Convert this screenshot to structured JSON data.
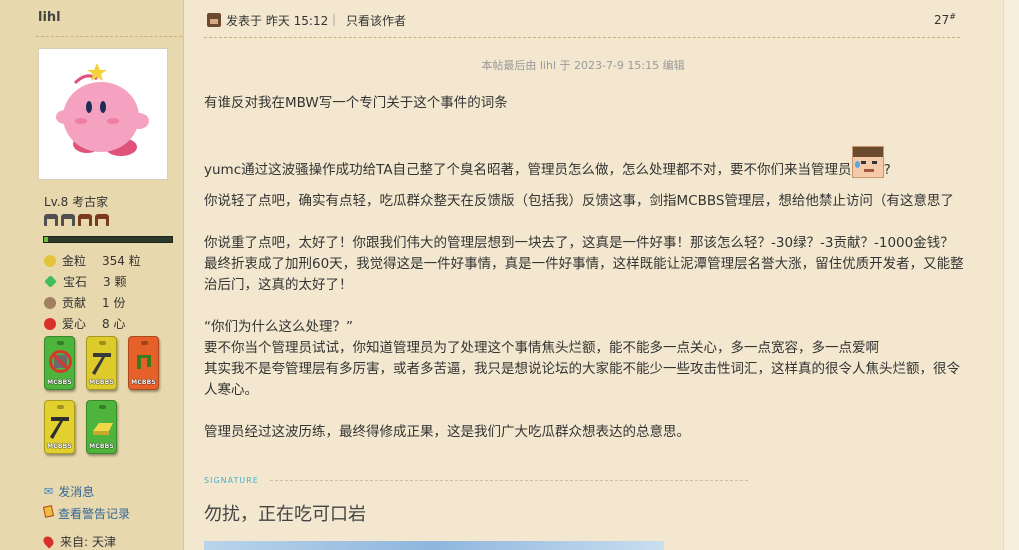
{
  "user": {
    "name": "lihl",
    "level": "Lv.8 考古家",
    "xp_fraction": 0.03,
    "stats": [
      {
        "name": "金粒",
        "value": "354 粒",
        "icon": "gold-nugget-icon",
        "color": "#e6c33a"
      },
      {
        "name": "宝石",
        "value": "3 颗",
        "icon": "emerald-icon",
        "color": "#3fbf5a"
      },
      {
        "name": "贡献",
        "value": "1 份",
        "icon": "contribution-icon",
        "color": "#a08060"
      },
      {
        "name": "爱心",
        "value": "8 心",
        "icon": "heart-apple-icon",
        "color": "#d8312a"
      }
    ],
    "badge_label": "MCBBS",
    "links": [
      {
        "label": "发消息",
        "icon": "mail-icon"
      },
      {
        "label": "查看警告记录",
        "icon": "warning-card-icon"
      }
    ],
    "origin_label": "来自:",
    "origin_value": "天津"
  },
  "post": {
    "posted_label": "发表于 昨天 15:12",
    "separator": "|",
    "only_author_label": "只看该作者",
    "floor_number": "27",
    "floor_mark": "#",
    "edited_note": "本帖最后由 lihl 于 2023-7-9 15:15 编辑",
    "paragraphs": [
      "有谁反对我在MBW写一个专门关于这个事件的词条",
      "yumc通过这波骚操作成功给TA自己整了个臭名昭著，管理员怎么做，怎么处理都不对，要不你们来当管理员",
      "你说轻了点吧，确实有点轻，吃瓜群众整天在反馈版（包括我）反馈这事，剑指MCBBS管理层，想给他禁止访问（有这意思了",
      "你说重了点吧，太好了！你跟我们伟大的管理层想到一块去了，这真是一件好事！那该怎么轻？-30绿？-3贡献？-1000金钱？最终折衷成了加刑60天，我觉得这是一件好事情，真是一件好事情，这样既能让泥潭管理层名誉大涨，留住优质开发者，又能整治后门，这真的太好了！"
    ],
    "paragraph2_suffix": "?",
    "quote_lines": [
      "“你们为什么这么处理？”",
      "要不你当个管理员试试，你知道管理员为了处理这个事情焦头烂额，能不能多一点关心，多一点宽容，多一点爱啊",
      "其实我不是夸管理层有多厉害，或者多苦逼，我只是想说论坛的大家能不能少一些攻击性词汇，这样真的很令人焦头烂额，很令人寒心。"
    ],
    "closing": "管理员经过这波历练，最终得修成正果，这是我们广大吃瓜群众想表达的总意思。",
    "signature_label": "SIGNATURE",
    "signature_text": "勿扰，正在吃可口岩"
  }
}
